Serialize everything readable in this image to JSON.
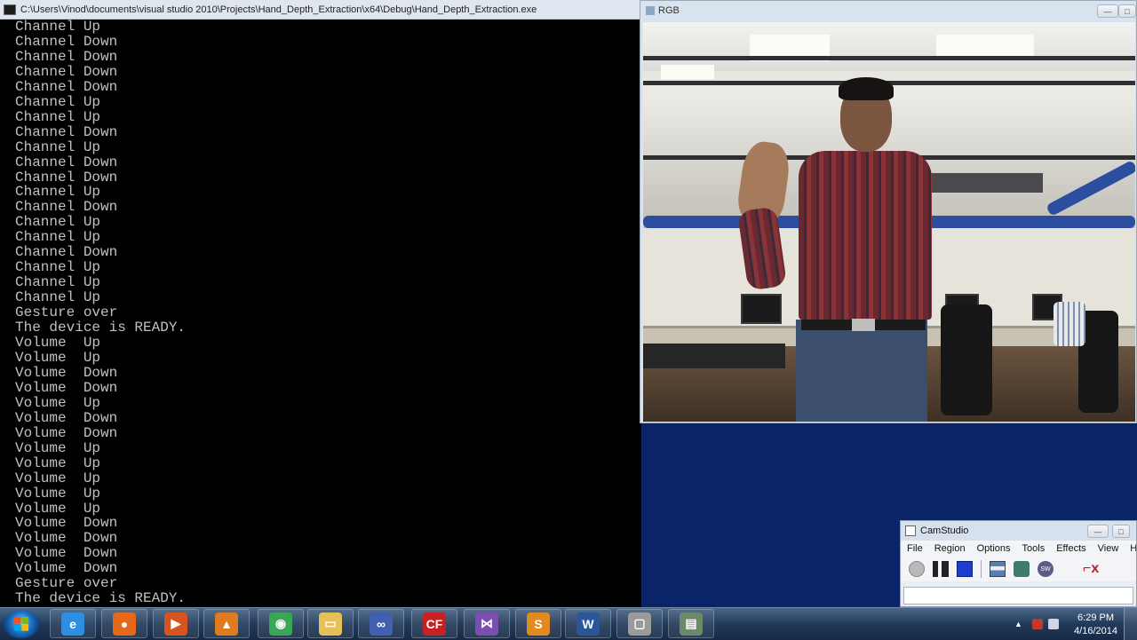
{
  "console": {
    "title": "C:\\Users\\Vinod\\documents\\visual studio 2010\\Projects\\Hand_Depth_Extraction\\x64\\Debug\\Hand_Depth_Extraction.exe",
    "lines": [
      "Channel Up",
      "Channel Down",
      "Channel Down",
      "Channel Down",
      "Channel Down",
      "Channel Up",
      "Channel Up",
      "Channel Down",
      "Channel Up",
      "Channel Down",
      "Channel Down",
      "Channel Up",
      "Channel Down",
      "Channel Up",
      "Channel Up",
      "Channel Down",
      "Channel Up",
      "Channel Up",
      "Channel Up",
      "Gesture over",
      "The device is READY.",
      "Volume  Up",
      "Volume  Up",
      "Volume  Down",
      "Volume  Down",
      "Volume  Up",
      "Volume  Down",
      "Volume  Down",
      "Volume  Up",
      "Volume  Up",
      "Volume  Up",
      "Volume  Up",
      "Volume  Up",
      "Volume  Down",
      "Volume  Down",
      "Volume  Down",
      "Volume  Down",
      "Gesture over",
      "The device is READY."
    ]
  },
  "rgb_window": {
    "title": "RGB",
    "minimize": "—",
    "maximize": "□"
  },
  "camstudio": {
    "title": "CamStudio",
    "menu": [
      "File",
      "Region",
      "Options",
      "Tools",
      "Effects",
      "View",
      "H"
    ],
    "toolbar_sw_label": "SW",
    "annotate_glyph": "⌐x"
  },
  "taskbar": {
    "apps": [
      {
        "name": "ie",
        "glyph": "e",
        "color": "#2c8fe0"
      },
      {
        "name": "firefox",
        "glyph": "●",
        "color": "#e6681a"
      },
      {
        "name": "media",
        "glyph": "▶",
        "color": "#d9531e"
      },
      {
        "name": "matlab",
        "glyph": "▲",
        "color": "#e07a1f"
      },
      {
        "name": "chrome",
        "glyph": "◉",
        "color": "#3aa757"
      },
      {
        "name": "explorer",
        "glyph": "▭",
        "color": "#e7c05a"
      },
      {
        "name": "app-infinity",
        "glyph": "∞",
        "color": "#4060b0"
      },
      {
        "name": "coldfusion",
        "glyph": "CF",
        "color": "#c82020"
      },
      {
        "name": "visual-studio",
        "glyph": "⋈",
        "color": "#7b4fb0"
      },
      {
        "name": "sublime",
        "glyph": "S",
        "color": "#e08a20"
      },
      {
        "name": "word",
        "glyph": "W",
        "color": "#2b579a"
      },
      {
        "name": "window-a",
        "glyph": "▢",
        "color": "#9a9a9a"
      },
      {
        "name": "window-b",
        "glyph": "▤",
        "color": "#6a8a6a"
      }
    ],
    "clock_time": "6:29 PM",
    "clock_date": "4/16/2014"
  }
}
